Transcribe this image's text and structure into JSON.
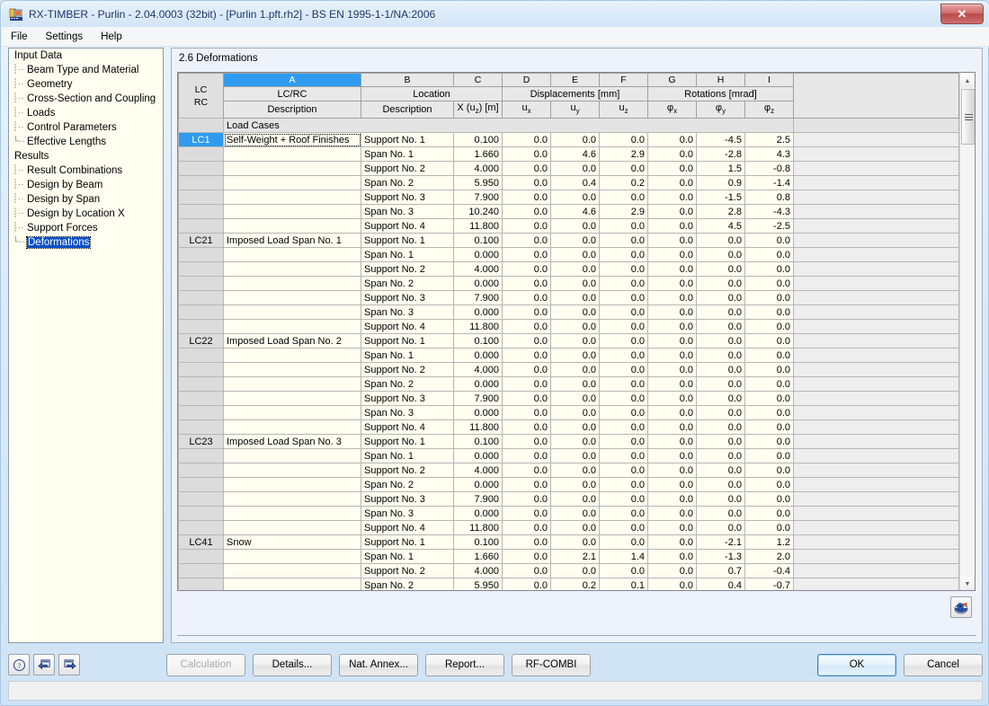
{
  "window": {
    "title": "RX-TIMBER - Purlin - 2.04.0003 (32bit) - [Purlin 1.pft.rh2] - BS EN 1995-1-1/NA:2006",
    "close_label": "✕"
  },
  "menu": [
    {
      "label": "File"
    },
    {
      "label": "Settings"
    },
    {
      "label": "Help"
    }
  ],
  "sidebar": {
    "groups": [
      {
        "label": "Input Data",
        "items": [
          {
            "label": "Beam Type and Material"
          },
          {
            "label": "Geometry"
          },
          {
            "label": "Cross-Section and Coupling"
          },
          {
            "label": "Loads"
          },
          {
            "label": "Control Parameters"
          },
          {
            "label": "Effective Lengths"
          }
        ]
      },
      {
        "label": "Results",
        "items": [
          {
            "label": "Result Combinations"
          },
          {
            "label": "Design by Beam"
          },
          {
            "label": "Design by Span"
          },
          {
            "label": "Design by Location X"
          },
          {
            "label": "Support Forces"
          },
          {
            "label": "Deformations"
          }
        ]
      }
    ],
    "selected": "Deformations"
  },
  "main": {
    "section_title": "2.6 Deformations",
    "grid": {
      "column_letters": [
        "A",
        "B",
        "C",
        "D",
        "E",
        "F",
        "G",
        "H",
        "I"
      ],
      "selected_column_letter": "A",
      "rc_header": [
        "LC",
        "RC"
      ],
      "group_headers": [
        {
          "label": "LC/RC",
          "span": 1
        },
        {
          "label": "Location",
          "span": 2
        },
        {
          "label": "Displacements [mm]",
          "span": 3
        },
        {
          "label": "Rotations [mrad]",
          "span": 3
        }
      ],
      "sub_headers": [
        "Description",
        "Description",
        "X (uz) [m]",
        "ux",
        "uy",
        "uz",
        "φx",
        "φy",
        "φz"
      ],
      "section_row_label": "Load Cases",
      "rows": [
        {
          "lc": "LC1",
          "selected": true,
          "desc": "Self-Weight + Roof Finishes",
          "desc_boxed": true,
          "loc": "Support No. 1",
          "x": "0.100",
          "ux": "0.0",
          "uy": "0.0",
          "uz": "0.0",
          "px": "0.0",
          "py": "-4.5",
          "pz": "2.5"
        },
        {
          "lc": "",
          "selected": false,
          "desc": "",
          "loc": "Span No. 1",
          "x": "1.660",
          "ux": "0.0",
          "uy": "4.6",
          "uz": "2.9",
          "px": "0.0",
          "py": "-2.8",
          "pz": "4.3"
        },
        {
          "lc": "",
          "selected": false,
          "desc": "",
          "loc": "Support No. 2",
          "x": "4.000",
          "ux": "0.0",
          "uy": "0.0",
          "uz": "0.0",
          "px": "0.0",
          "py": "1.5",
          "pz": "-0.8"
        },
        {
          "lc": "",
          "selected": false,
          "desc": "",
          "loc": "Span No. 2",
          "x": "5.950",
          "ux": "0.0",
          "uy": "0.4",
          "uz": "0.2",
          "px": "0.0",
          "py": "0.9",
          "pz": "-1.4"
        },
        {
          "lc": "",
          "selected": false,
          "desc": "",
          "loc": "Support No. 3",
          "x": "7.900",
          "ux": "0.0",
          "uy": "0.0",
          "uz": "0.0",
          "px": "0.0",
          "py": "-1.5",
          "pz": "0.8"
        },
        {
          "lc": "",
          "selected": false,
          "desc": "",
          "loc": "Span No. 3",
          "x": "10.240",
          "ux": "0.0",
          "uy": "4.6",
          "uz": "2.9",
          "px": "0.0",
          "py": "2.8",
          "pz": "-4.3"
        },
        {
          "lc": "",
          "selected": false,
          "desc": "",
          "loc": "Support No. 4",
          "x": "11.800",
          "ux": "0.0",
          "uy": "0.0",
          "uz": "0.0",
          "px": "0.0",
          "py": "4.5",
          "pz": "-2.5"
        },
        {
          "lc": "LC21",
          "selected": false,
          "desc": "Imposed Load Span No. 1",
          "loc": "Support No. 1",
          "x": "0.100",
          "ux": "0.0",
          "uy": "0.0",
          "uz": "0.0",
          "px": "0.0",
          "py": "0.0",
          "pz": "0.0"
        },
        {
          "lc": "",
          "selected": false,
          "desc": "",
          "loc": "Span No. 1",
          "x": "0.000",
          "ux": "0.0",
          "uy": "0.0",
          "uz": "0.0",
          "px": "0.0",
          "py": "0.0",
          "pz": "0.0"
        },
        {
          "lc": "",
          "selected": false,
          "desc": "",
          "loc": "Support No. 2",
          "x": "4.000",
          "ux": "0.0",
          "uy": "0.0",
          "uz": "0.0",
          "px": "0.0",
          "py": "0.0",
          "pz": "0.0"
        },
        {
          "lc": "",
          "selected": false,
          "desc": "",
          "loc": "Span No. 2",
          "x": "0.000",
          "ux": "0.0",
          "uy": "0.0",
          "uz": "0.0",
          "px": "0.0",
          "py": "0.0",
          "pz": "0.0"
        },
        {
          "lc": "",
          "selected": false,
          "desc": "",
          "loc": "Support No. 3",
          "x": "7.900",
          "ux": "0.0",
          "uy": "0.0",
          "uz": "0.0",
          "px": "0.0",
          "py": "0.0",
          "pz": "0.0"
        },
        {
          "lc": "",
          "selected": false,
          "desc": "",
          "loc": "Span No. 3",
          "x": "0.000",
          "ux": "0.0",
          "uy": "0.0",
          "uz": "0.0",
          "px": "0.0",
          "py": "0.0",
          "pz": "0.0"
        },
        {
          "lc": "",
          "selected": false,
          "desc": "",
          "loc": "Support No. 4",
          "x": "11.800",
          "ux": "0.0",
          "uy": "0.0",
          "uz": "0.0",
          "px": "0.0",
          "py": "0.0",
          "pz": "0.0"
        },
        {
          "lc": "LC22",
          "selected": false,
          "desc": "Imposed Load Span No. 2",
          "loc": "Support No. 1",
          "x": "0.100",
          "ux": "0.0",
          "uy": "0.0",
          "uz": "0.0",
          "px": "0.0",
          "py": "0.0",
          "pz": "0.0"
        },
        {
          "lc": "",
          "selected": false,
          "desc": "",
          "loc": "Span No. 1",
          "x": "0.000",
          "ux": "0.0",
          "uy": "0.0",
          "uz": "0.0",
          "px": "0.0",
          "py": "0.0",
          "pz": "0.0"
        },
        {
          "lc": "",
          "selected": false,
          "desc": "",
          "loc": "Support No. 2",
          "x": "4.000",
          "ux": "0.0",
          "uy": "0.0",
          "uz": "0.0",
          "px": "0.0",
          "py": "0.0",
          "pz": "0.0"
        },
        {
          "lc": "",
          "selected": false,
          "desc": "",
          "loc": "Span No. 2",
          "x": "0.000",
          "ux": "0.0",
          "uy": "0.0",
          "uz": "0.0",
          "px": "0.0",
          "py": "0.0",
          "pz": "0.0"
        },
        {
          "lc": "",
          "selected": false,
          "desc": "",
          "loc": "Support No. 3",
          "x": "7.900",
          "ux": "0.0",
          "uy": "0.0",
          "uz": "0.0",
          "px": "0.0",
          "py": "0.0",
          "pz": "0.0"
        },
        {
          "lc": "",
          "selected": false,
          "desc": "",
          "loc": "Span No. 3",
          "x": "0.000",
          "ux": "0.0",
          "uy": "0.0",
          "uz": "0.0",
          "px": "0.0",
          "py": "0.0",
          "pz": "0.0"
        },
        {
          "lc": "",
          "selected": false,
          "desc": "",
          "loc": "Support No. 4",
          "x": "11.800",
          "ux": "0.0",
          "uy": "0.0",
          "uz": "0.0",
          "px": "0.0",
          "py": "0.0",
          "pz": "0.0"
        },
        {
          "lc": "LC23",
          "selected": false,
          "desc": "Imposed Load Span No. 3",
          "loc": "Support No. 1",
          "x": "0.100",
          "ux": "0.0",
          "uy": "0.0",
          "uz": "0.0",
          "px": "0.0",
          "py": "0.0",
          "pz": "0.0"
        },
        {
          "lc": "",
          "selected": false,
          "desc": "",
          "loc": "Span No. 1",
          "x": "0.000",
          "ux": "0.0",
          "uy": "0.0",
          "uz": "0.0",
          "px": "0.0",
          "py": "0.0",
          "pz": "0.0"
        },
        {
          "lc": "",
          "selected": false,
          "desc": "",
          "loc": "Support No. 2",
          "x": "4.000",
          "ux": "0.0",
          "uy": "0.0",
          "uz": "0.0",
          "px": "0.0",
          "py": "0.0",
          "pz": "0.0"
        },
        {
          "lc": "",
          "selected": false,
          "desc": "",
          "loc": "Span No. 2",
          "x": "0.000",
          "ux": "0.0",
          "uy": "0.0",
          "uz": "0.0",
          "px": "0.0",
          "py": "0.0",
          "pz": "0.0"
        },
        {
          "lc": "",
          "selected": false,
          "desc": "",
          "loc": "Support No. 3",
          "x": "7.900",
          "ux": "0.0",
          "uy": "0.0",
          "uz": "0.0",
          "px": "0.0",
          "py": "0.0",
          "pz": "0.0"
        },
        {
          "lc": "",
          "selected": false,
          "desc": "",
          "loc": "Span No. 3",
          "x": "0.000",
          "ux": "0.0",
          "uy": "0.0",
          "uz": "0.0",
          "px": "0.0",
          "py": "0.0",
          "pz": "0.0"
        },
        {
          "lc": "",
          "selected": false,
          "desc": "",
          "loc": "Support No. 4",
          "x": "11.800",
          "ux": "0.0",
          "uy": "0.0",
          "uz": "0.0",
          "px": "0.0",
          "py": "0.0",
          "pz": "0.0"
        },
        {
          "lc": "LC41",
          "selected": false,
          "desc": "Snow",
          "loc": "Support No. 1",
          "x": "0.100",
          "ux": "0.0",
          "uy": "0.0",
          "uz": "0.0",
          "px": "0.0",
          "py": "-2.1",
          "pz": "1.2"
        },
        {
          "lc": "",
          "selected": false,
          "desc": "",
          "loc": "Span No. 1",
          "x": "1.660",
          "ux": "0.0",
          "uy": "2.1",
          "uz": "1.4",
          "px": "0.0",
          "py": "-1.3",
          "pz": "2.0"
        },
        {
          "lc": "",
          "selected": false,
          "desc": "",
          "loc": "Support No. 2",
          "x": "4.000",
          "ux": "0.0",
          "uy": "0.0",
          "uz": "0.0",
          "px": "0.0",
          "py": "0.7",
          "pz": "-0.4"
        },
        {
          "lc": "",
          "selected": false,
          "desc": "",
          "loc": "Span No. 2",
          "x": "5.950",
          "ux": "0.0",
          "uy": "0.2",
          "uz": "0.1",
          "px": "0.0",
          "py": "0.4",
          "pz": "-0.7"
        }
      ]
    },
    "scrollbar": {
      "up": "▲",
      "down": "▼"
    },
    "graphics_button_title": "graphics"
  },
  "bottom": {
    "icon_buttons": [
      {
        "name": "help-button",
        "glyph": "?"
      },
      {
        "name": "prev-button",
        "glyph": "◄"
      },
      {
        "name": "next-button",
        "glyph": "►"
      }
    ],
    "buttons": [
      {
        "label": "Calculation",
        "disabled": true
      },
      {
        "label": "Details...",
        "disabled": false
      },
      {
        "label": "Nat. Annex...",
        "disabled": false
      },
      {
        "label": "Report...",
        "disabled": false
      },
      {
        "label": "RF-COMBI",
        "disabled": false
      }
    ],
    "ok_label": "OK",
    "cancel_label": "Cancel"
  }
}
